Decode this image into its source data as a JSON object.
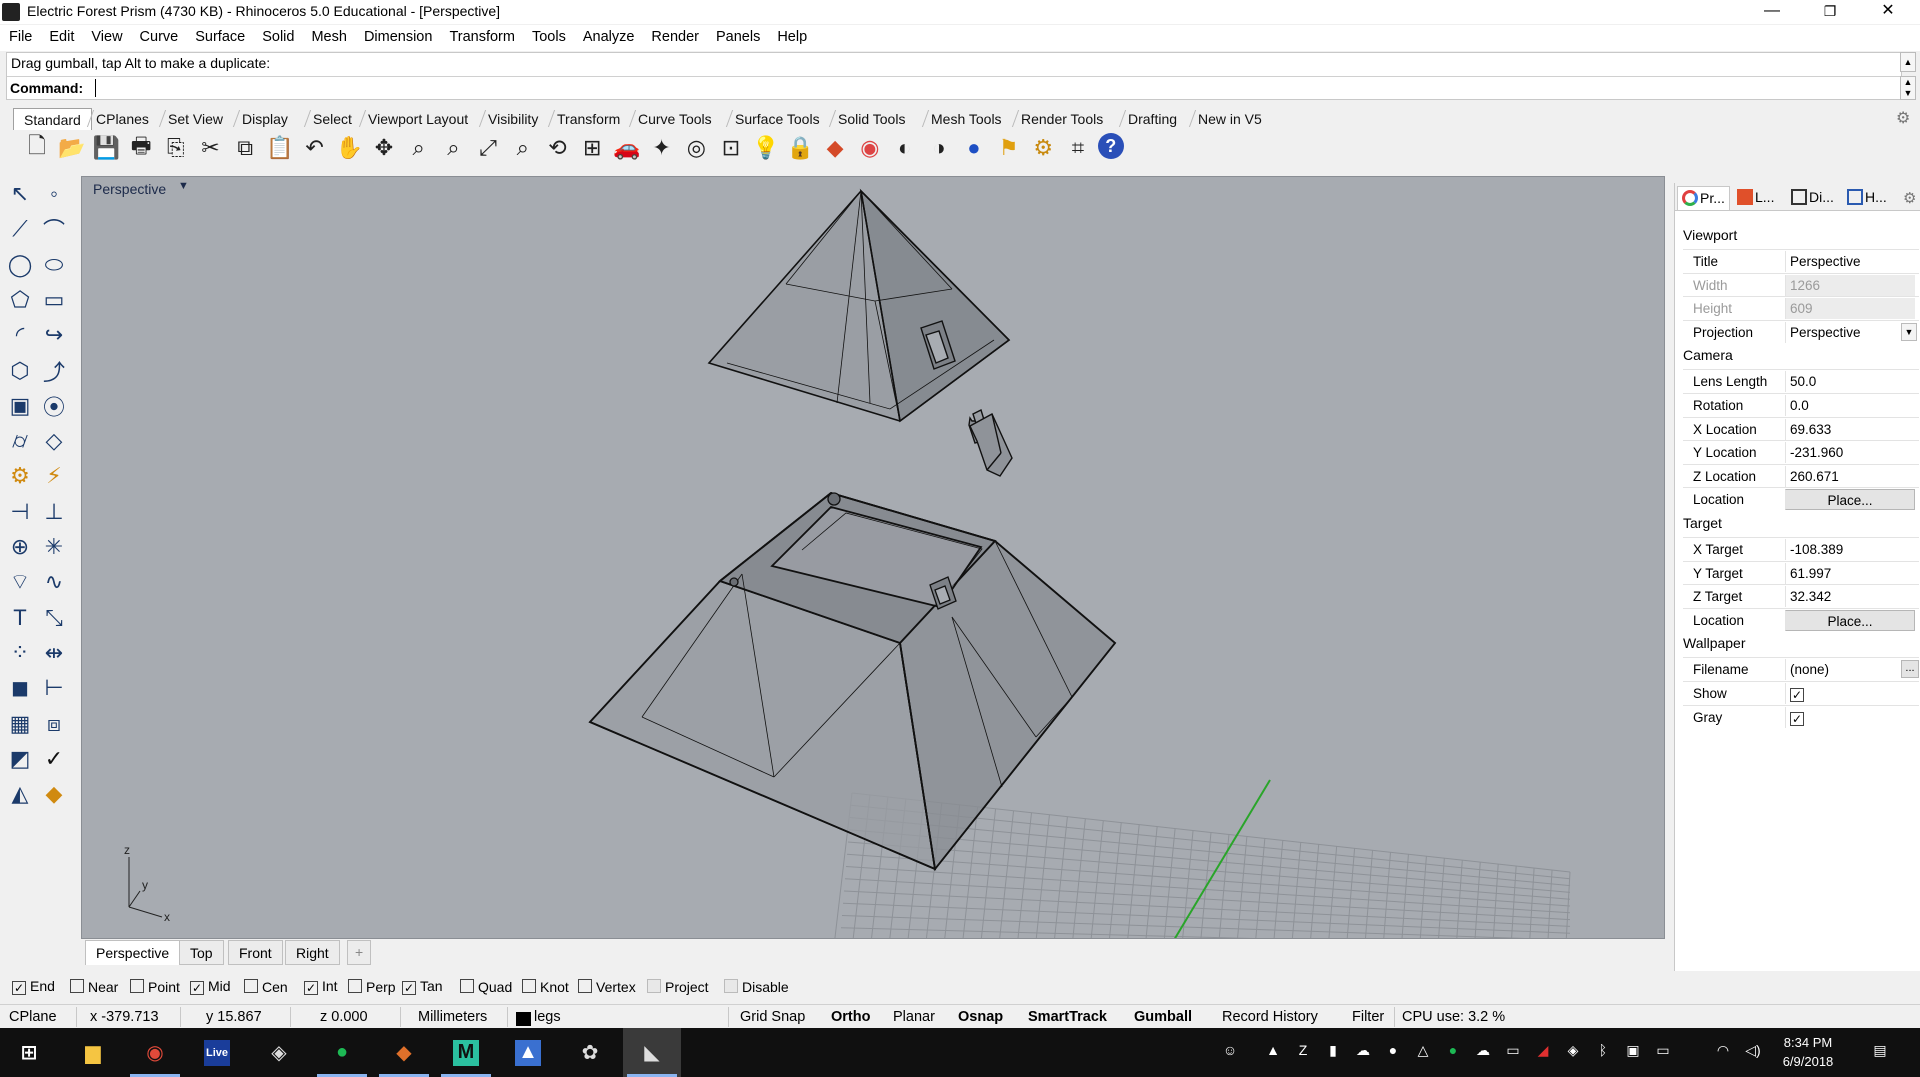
{
  "window": {
    "title": "Electric Forest Prism (4730 KB) - Rhinoceros 5.0 Educational - [Perspective]",
    "minimize": "—",
    "restore": "❐",
    "close": "✕"
  },
  "menu": [
    "File",
    "Edit",
    "View",
    "Curve",
    "Surface",
    "Solid",
    "Mesh",
    "Dimension",
    "Transform",
    "Tools",
    "Analyze",
    "Render",
    "Panels",
    "Help"
  ],
  "command": {
    "history": "Drag gumball, tap Alt to make a duplicate:",
    "label": "Command:",
    "value": ""
  },
  "toolbar_tabs": [
    "Standard",
    "CPlanes",
    "Set View",
    "Display",
    "Select",
    "Viewport Layout",
    "Visibility",
    "Transform",
    "Curve Tools",
    "Surface Tools",
    "Solid Tools",
    "Mesh Tools",
    "Render Tools",
    "Drafting",
    "New in V5"
  ],
  "toolbar_active": "Standard",
  "toolbar_icons": [
    "new-file-icon",
    "open-file-icon",
    "save-icon",
    "print-icon",
    "import-icon",
    "cut-icon",
    "copy-icon",
    "paste-icon",
    "undo-icon",
    "pan-hand-icon",
    "rotate-view-icon",
    "zoom-window-icon",
    "zoom-dynamic-icon",
    "zoom-extents-icon",
    "zoom-selected-icon",
    "undo-view-icon",
    "four-viewports-icon",
    "car-icon",
    "point-object-icon",
    "grid-snap-icon",
    "select-options-icon",
    "light-icon",
    "lock-icon",
    "layer-icon",
    "color-wheel-icon",
    "shaded-sphere-icon",
    "render-sphere-icon",
    "blue-sphere-icon",
    "flag-icon",
    "settings-gears-icon",
    "dimension-icon",
    "help-icon"
  ],
  "viewport": {
    "title": "Perspective",
    "axis_labels": {
      "z": "z",
      "y": "y",
      "x": "x"
    }
  },
  "viewport_tabs": [
    "Perspective",
    "Top",
    "Front",
    "Right"
  ],
  "viewport_tab_add": "+",
  "properties": {
    "tabs": [
      "Pr...",
      "L...",
      "Di...",
      "H..."
    ],
    "sections": [
      {
        "title": "Viewport",
        "rows": [
          {
            "key": "Title",
            "value": "Perspective"
          },
          {
            "key": "Width",
            "value": "1266",
            "disabled": true
          },
          {
            "key": "Height",
            "value": "609",
            "disabled": true
          },
          {
            "key": "Projection",
            "value": "Perspective",
            "dropdown": true
          }
        ]
      },
      {
        "title": "Camera",
        "rows": [
          {
            "key": "Lens Length",
            "value": "50.0"
          },
          {
            "key": "Rotation",
            "value": "0.0"
          },
          {
            "key": "X Location",
            "value": "69.633"
          },
          {
            "key": "Y Location",
            "value": "-231.960"
          },
          {
            "key": "Z Location",
            "value": "260.671"
          },
          {
            "key": "Location",
            "value": "Place...",
            "button": true
          }
        ]
      },
      {
        "title": "Target",
        "rows": [
          {
            "key": "X Target",
            "value": "-108.389"
          },
          {
            "key": "Y Target",
            "value": "61.997"
          },
          {
            "key": "Z Target",
            "value": "32.342"
          },
          {
            "key": "Location",
            "value": "Place...",
            "button": true
          }
        ]
      },
      {
        "title": "Wallpaper",
        "rows": [
          {
            "key": "Filename",
            "value": "(none)",
            "browse": "..."
          },
          {
            "key": "Show",
            "checked": true
          },
          {
            "key": "Gray",
            "checked": true
          }
        ]
      }
    ]
  },
  "osnaps": [
    {
      "label": "End",
      "checked": true
    },
    {
      "label": "Near",
      "checked": false
    },
    {
      "label": "Point",
      "checked": false
    },
    {
      "label": "Mid",
      "checked": true
    },
    {
      "label": "Cen",
      "checked": false
    },
    {
      "label": "Int",
      "checked": true
    },
    {
      "label": "Perp",
      "checked": false
    },
    {
      "label": "Tan",
      "checked": true
    },
    {
      "label": "Quad",
      "checked": false
    },
    {
      "label": "Knot",
      "checked": false
    },
    {
      "label": "Vertex",
      "checked": false
    },
    {
      "label": "Project",
      "checked": false,
      "disabled": true
    },
    {
      "label": "Disable",
      "checked": false,
      "disabled": true
    }
  ],
  "status": {
    "cplane": "CPlane",
    "x": "x -379.713",
    "y": "y 15.867",
    "z": "z 0.000",
    "units": "Millimeters",
    "layer": "legs",
    "layer_color": "#000000",
    "grid_snap": "Grid Snap",
    "ortho": "Ortho",
    "planar": "Planar",
    "osnap": "Osnap",
    "smarttrack": "SmartTrack",
    "gumball": "Gumball",
    "record_history": "Record History",
    "filter": "Filter",
    "cpu": "CPU use: 3.2 %"
  },
  "taskbar": {
    "apps": [
      "windows-start-icon",
      "file-explorer-icon",
      "chrome-icon",
      "live-app-icon",
      "unity-icon",
      "spotify-icon",
      "paint-app-icon",
      "m-app-icon",
      "drive-app-icon",
      "paint-bucket-icon",
      "rhino-icon"
    ],
    "live_label": "Live",
    "time": "8:34 PM",
    "date": "6/9/2018"
  },
  "colors": {
    "viewport_bg": "#a7abb1",
    "grid_line": "#8e9298",
    "y_axis": "#2aa52a",
    "model_fill": "#8f9399",
    "model_edge": "#111111",
    "taskbar_bg": "#101010"
  }
}
